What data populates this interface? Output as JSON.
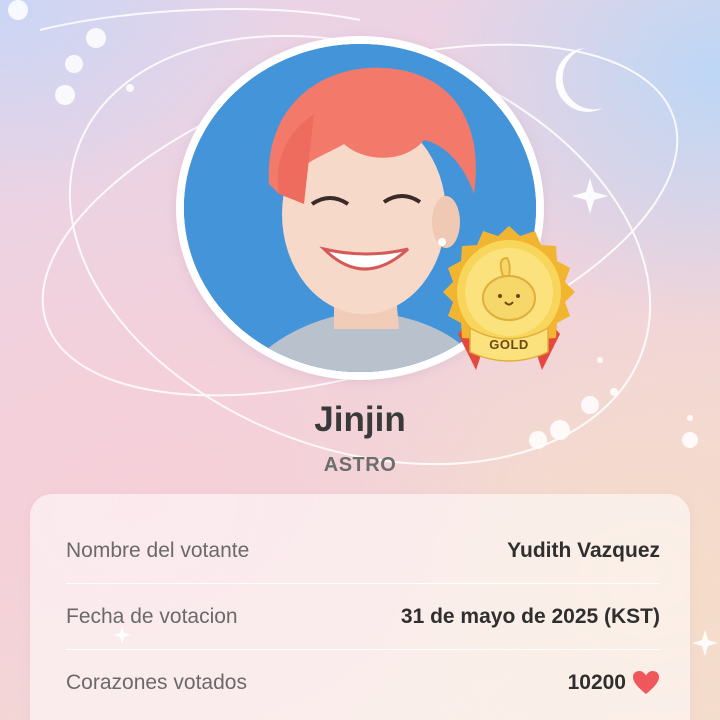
{
  "idol": {
    "name": "Jinjin",
    "group": "ASTRO",
    "badge_label": "GOLD"
  },
  "details": [
    {
      "label": "Nombre del votante",
      "value": "Yudith Vazquez"
    },
    {
      "label": "Fecha de votacion",
      "value": "31 de mayo de 2025 (KST)"
    },
    {
      "label": "Corazones votados",
      "value": "10200",
      "icon": "heart-icon"
    }
  ],
  "colors": {
    "heart": "#f0575c",
    "badge_gold": "#f4c542",
    "badge_ribbon": "#e4483f",
    "photo_bg": "#3f8fd6",
    "hair": "#f37a6a"
  }
}
